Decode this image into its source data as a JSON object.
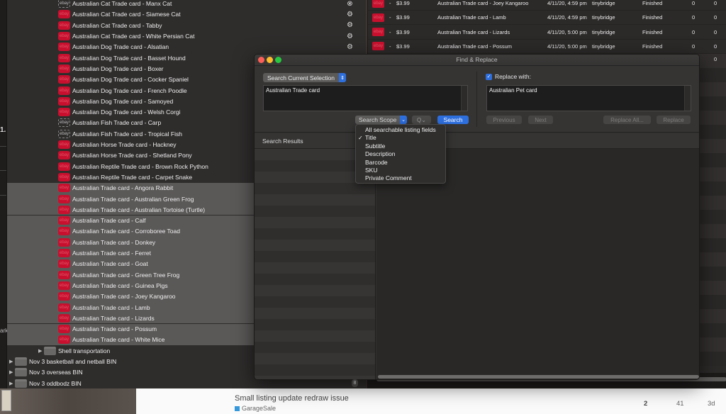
{
  "colors": {
    "ebay_red": "#c8102e",
    "accent_blue": "#2e6fde",
    "category_blue": "#3498db"
  },
  "left_strip": {
    "fragment_1": "1.",
    "fragment_2": "ark"
  },
  "tree": {
    "listings": [
      {
        "label": "Australian Cat Trade card - Manx Cat",
        "ebay_state": "draft",
        "selected": false,
        "status_icon": "remove-icon"
      },
      {
        "label": "Australian Cat Trade card - Siamese Cat",
        "ebay_state": "active",
        "selected": false,
        "status_icon": "sync-icon"
      },
      {
        "label": "Australian Cat Trade card - Tabby",
        "ebay_state": "active",
        "selected": false,
        "status_icon": "sync-icon"
      },
      {
        "label": "Australian Cat Trade card - White Persian Cat",
        "ebay_state": "active",
        "selected": false,
        "status_icon": "sync-icon"
      },
      {
        "label": "Australian Dog Trade card - Alsatian",
        "ebay_state": "active",
        "selected": false,
        "status_icon": "sync-icon"
      },
      {
        "label": "Australian Dog Trade card - Basset Hound",
        "ebay_state": "active",
        "selected": false
      },
      {
        "label": "Australian Dog Trade card - Boxer",
        "ebay_state": "active",
        "selected": false
      },
      {
        "label": "Australian Dog Trade card - Cocker Spaniel",
        "ebay_state": "active",
        "selected": false
      },
      {
        "label": "Australian Dog Trade card - French Poodle",
        "ebay_state": "active",
        "selected": false
      },
      {
        "label": "Australian Dog Trade card - Samoyed",
        "ebay_state": "active",
        "selected": false
      },
      {
        "label": "Australian Dog Trade card - Welsh Corgi",
        "ebay_state": "active",
        "selected": false
      },
      {
        "label": "Australian Fish Trade card - Carp",
        "ebay_state": "draft",
        "selected": false
      },
      {
        "label": "Australian Fish Trade card - Tropical Fish",
        "ebay_state": "draft",
        "selected": false
      },
      {
        "label": "Australian Horse Trade card - Hackney",
        "ebay_state": "active",
        "selected": false
      },
      {
        "label": "Australian Horse Trade card - Shetland Pony",
        "ebay_state": "active",
        "selected": false
      },
      {
        "label": "Australian Reptile Trade card - Brown Rock Python",
        "ebay_state": "active",
        "selected": false
      },
      {
        "label": "Australian Reptile Trade card - Carpet Snake",
        "ebay_state": "active",
        "selected": false
      },
      {
        "label": "Australian Trade card - Angora Rabbit",
        "ebay_state": "active",
        "selected": true
      },
      {
        "label": "Australian Trade card - Australian Green Frog",
        "ebay_state": "active",
        "selected": true
      },
      {
        "label": "Australian Trade card - Australian Tortoise (Turtle)",
        "ebay_state": "active",
        "selected": true
      },
      {
        "label": "Australian Trade card - Calf",
        "ebay_state": "active",
        "selected": true
      },
      {
        "label": "Australian Trade card - Corroboree Toad",
        "ebay_state": "active",
        "selected": true
      },
      {
        "label": "Australian Trade card - Donkey",
        "ebay_state": "active",
        "selected": true
      },
      {
        "label": "Australian Trade card - Ferret",
        "ebay_state": "active",
        "selected": true
      },
      {
        "label": "Australian Trade card - Goat",
        "ebay_state": "active",
        "selected": true
      },
      {
        "label": "Australian Trade card - Green Tree Frog",
        "ebay_state": "active",
        "selected": true
      },
      {
        "label": "Australian Trade card - Guinea Pigs",
        "ebay_state": "active",
        "selected": true
      },
      {
        "label": "Australian Trade card - Joey Kangaroo",
        "ebay_state": "active",
        "selected": true
      },
      {
        "label": "Australian Trade card - Lamb",
        "ebay_state": "active",
        "selected": true
      },
      {
        "label": "Australian Trade card - Lizards",
        "ebay_state": "active",
        "selected": true
      },
      {
        "label": "Australian Trade card - Possum",
        "ebay_state": "active",
        "selected": true
      },
      {
        "label": "Australian Trade card - White Mice",
        "ebay_state": "active",
        "selected": true
      }
    ],
    "ebay_badge": "ebay",
    "subfolder": {
      "label": "Shell transportation"
    },
    "folders": [
      {
        "label": "Nov 3 basketball and netball BIN"
      },
      {
        "label": "Nov 3 overseas BIN"
      },
      {
        "label": "Nov 3 oddbodz BIN"
      }
    ]
  },
  "table": {
    "rows": [
      {
        "dash": "-",
        "price": "$3.99",
        "title": "Australian Trade card - Joey Kangaroo",
        "date": "4/11/20, 4:59 pm",
        "account": "tinybridge",
        "status": "Finished",
        "col_a": "0",
        "col_b": "0"
      },
      {
        "dash": "-",
        "price": "$3.99",
        "title": "Australian Trade card - Lamb",
        "date": "4/11/20, 4:59 pm",
        "account": "tinybridge",
        "status": "Finished",
        "col_a": "0",
        "col_b": "0"
      },
      {
        "dash": "-",
        "price": "$3.99",
        "title": "Australian Trade card - Lizards",
        "date": "4/11/20, 5:00 pm",
        "account": "tinybridge",
        "status": "Finished",
        "col_a": "0",
        "col_b": "0"
      },
      {
        "dash": "-",
        "price": "$3.99",
        "title": "Australian Trade card - Possum",
        "date": "4/11/20, 5:00 pm",
        "account": "tinybridge",
        "status": "Finished",
        "col_a": "0",
        "col_b": "0"
      }
    ],
    "ebay_badge": "ebay",
    "peek_value": "0",
    "side_badge": "8"
  },
  "find_replace": {
    "window_title": "Find & Replace",
    "search_mode": "Search Current Selection",
    "search_mode_arrow": "⇕",
    "find_text": "Australian Trade card",
    "scope_label": "Search Scope",
    "scope_arrow": "⌄",
    "magnifier": "Q⌄",
    "search_button": "Search",
    "replace_checkbox_label": "Replace with:",
    "replace_checked": true,
    "check_mark": "✓",
    "replace_text": "Australian Pet card",
    "previous_button": "Previous",
    "next_button": "Next",
    "replace_all_button": "Replace All...",
    "replace_button": "Replace",
    "results_header": "Search Results"
  },
  "scope_menu": {
    "items": [
      {
        "label": "All searchable listing fields",
        "checked": false
      },
      {
        "label": "Title",
        "checked": true
      },
      {
        "label": "Subtitle",
        "checked": false
      },
      {
        "label": "Description",
        "checked": false
      },
      {
        "label": "Barcode",
        "checked": false
      },
      {
        "label": "SKU",
        "checked": false
      },
      {
        "label": "Private Comment",
        "checked": false
      }
    ],
    "check_mark": "✓"
  },
  "forum": {
    "topic_title": "Small listing update redraw issue",
    "category": "GarageSale",
    "replies": "2",
    "views": "41",
    "activity": "3d"
  }
}
